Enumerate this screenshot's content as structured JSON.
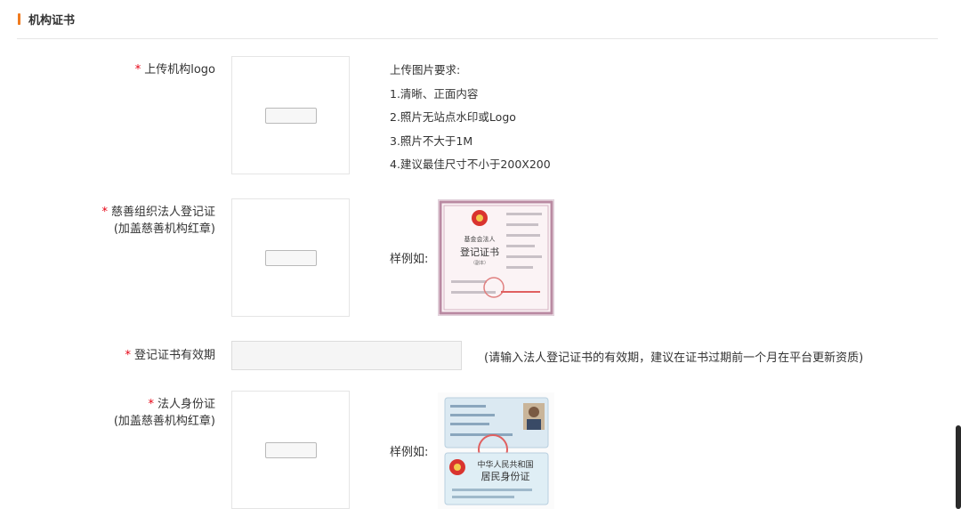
{
  "section": {
    "title": "机构证书"
  },
  "fields": {
    "logo": {
      "required_mark": "*",
      "label": "上传机构logo"
    },
    "charity_cert": {
      "required_mark": "*",
      "label_line1": "慈善组织法人登记证",
      "label_line2": "(加盖慈善机构红章)"
    },
    "cert_validity": {
      "required_mark": "*",
      "label": "登记证书有效期",
      "value": "",
      "hint": "(请输入法人登记证书的有效期，建议在证书过期前一个月在平台更新资质)"
    },
    "legal_id": {
      "required_mark": "*",
      "label_line1": "法人身份证",
      "label_line2": "(加盖慈善机构红章)"
    }
  },
  "upload_requirements": {
    "title": "上传图片要求:",
    "items": [
      "1.清晰、正面内容",
      "2.照片无站点水印或Logo",
      "3.照片不大于1M",
      "4.建议最佳尺寸不小于200X200"
    ]
  },
  "samples": {
    "label": "样例如:",
    "cert": {
      "line1": "基金会法人",
      "line2": "登记证书",
      "line3": "（副本）"
    },
    "id_card": {
      "back_title": "中华人民共和国",
      "back_subtitle": "居民身份证"
    }
  },
  "colors": {
    "accent": "#f07b1f",
    "required": "#e60012"
  }
}
